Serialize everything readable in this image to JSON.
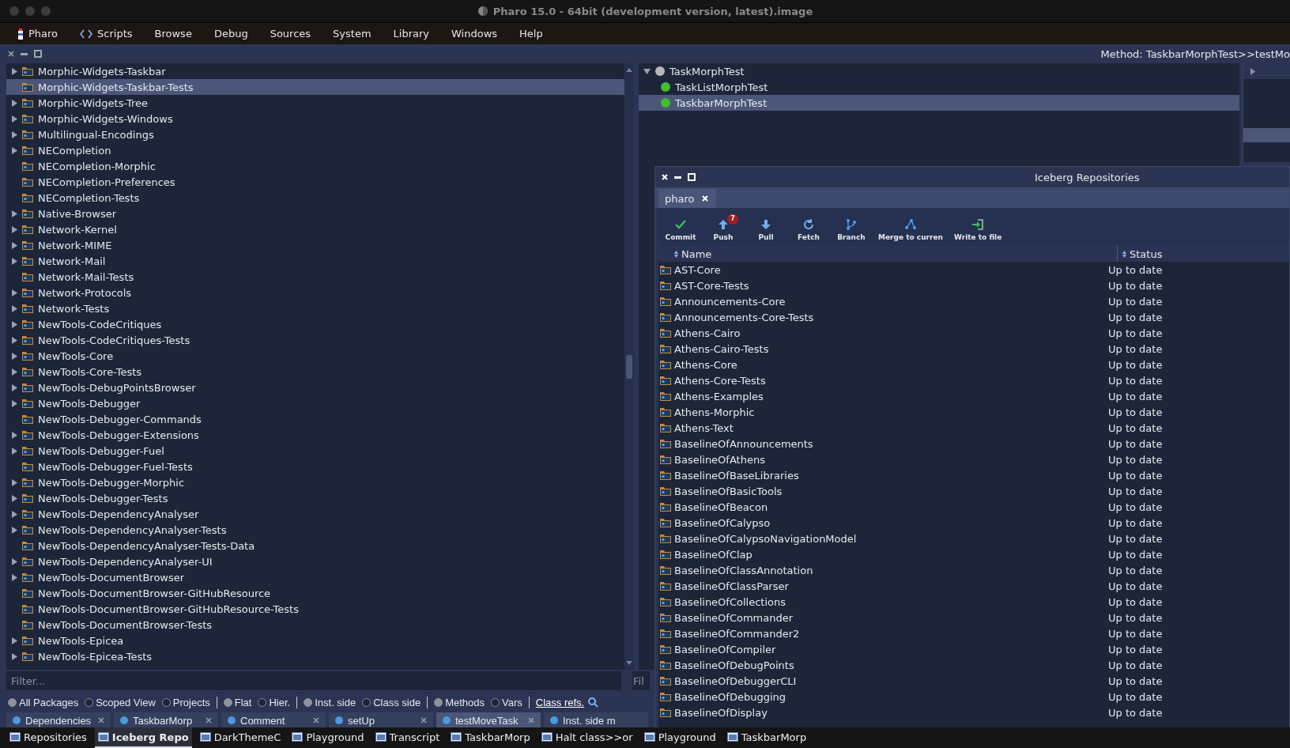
{
  "window": {
    "title": "Pharo 15.0 - 64bit (development version, latest).image"
  },
  "menu_bar": [
    {
      "label": "Pharo"
    },
    {
      "label": "Scripts"
    },
    {
      "label": "Browse"
    },
    {
      "label": "Debug"
    },
    {
      "label": "Sources"
    },
    {
      "label": "System"
    },
    {
      "label": "Library"
    },
    {
      "label": "Windows"
    },
    {
      "label": "Help"
    }
  ],
  "browser": {
    "header": "Method: TaskbarMorphTest>>testMo",
    "packages": [
      {
        "name": "Morphic-Widgets-Taskbar",
        "expandable": true,
        "selected": false
      },
      {
        "name": "Morphic-Widgets-Taskbar-Tests",
        "expandable": false,
        "selected": true
      },
      {
        "name": "Morphic-Widgets-Tree",
        "expandable": true,
        "selected": false
      },
      {
        "name": "Morphic-Widgets-Windows",
        "expandable": true,
        "selected": false
      },
      {
        "name": "Multilingual-Encodings",
        "expandable": true,
        "selected": false
      },
      {
        "name": "NECompletion",
        "expandable": true,
        "selected": false
      },
      {
        "name": "NECompletion-Morphic",
        "expandable": false,
        "selected": false
      },
      {
        "name": "NECompletion-Preferences",
        "expandable": false,
        "selected": false
      },
      {
        "name": "NECompletion-Tests",
        "expandable": false,
        "selected": false
      },
      {
        "name": "Native-Browser",
        "expandable": true,
        "selected": false
      },
      {
        "name": "Network-Kernel",
        "expandable": true,
        "selected": false
      },
      {
        "name": "Network-MIME",
        "expandable": true,
        "selected": false
      },
      {
        "name": "Network-Mail",
        "expandable": true,
        "selected": false
      },
      {
        "name": "Network-Mail-Tests",
        "expandable": false,
        "selected": false
      },
      {
        "name": "Network-Protocols",
        "expandable": true,
        "selected": false
      },
      {
        "name": "Network-Tests",
        "expandable": true,
        "selected": false
      },
      {
        "name": "NewTools-CodeCritiques",
        "expandable": true,
        "selected": false
      },
      {
        "name": "NewTools-CodeCritiques-Tests",
        "expandable": true,
        "selected": false
      },
      {
        "name": "NewTools-Core",
        "expandable": true,
        "selected": false
      },
      {
        "name": "NewTools-Core-Tests",
        "expandable": true,
        "selected": false
      },
      {
        "name": "NewTools-DebugPointsBrowser",
        "expandable": true,
        "selected": false
      },
      {
        "name": "NewTools-Debugger",
        "expandable": true,
        "selected": false
      },
      {
        "name": "NewTools-Debugger-Commands",
        "expandable": false,
        "selected": false
      },
      {
        "name": "NewTools-Debugger-Extensions",
        "expandable": true,
        "selected": false
      },
      {
        "name": "NewTools-Debugger-Fuel",
        "expandable": true,
        "selected": false
      },
      {
        "name": "NewTools-Debugger-Fuel-Tests",
        "expandable": false,
        "selected": false
      },
      {
        "name": "NewTools-Debugger-Morphic",
        "expandable": true,
        "selected": false
      },
      {
        "name": "NewTools-Debugger-Tests",
        "expandable": true,
        "selected": false
      },
      {
        "name": "NewTools-DependencyAnalyser",
        "expandable": true,
        "selected": false
      },
      {
        "name": "NewTools-DependencyAnalyser-Tests",
        "expandable": true,
        "selected": false
      },
      {
        "name": "NewTools-DependencyAnalyser-Tests-Data",
        "expandable": false,
        "selected": false
      },
      {
        "name": "NewTools-DependencyAnalyser-UI",
        "expandable": true,
        "selected": false
      },
      {
        "name": "NewTools-DocumentBrowser",
        "expandable": true,
        "selected": false
      },
      {
        "name": "NewTools-DocumentBrowser-GitHubResource",
        "expandable": false,
        "selected": false
      },
      {
        "name": "NewTools-DocumentBrowser-GitHubResource-Tests",
        "expandable": false,
        "selected": false
      },
      {
        "name": "NewTools-DocumentBrowser-Tests",
        "expandable": false,
        "selected": false
      },
      {
        "name": "NewTools-Epicea",
        "expandable": true,
        "selected": false
      },
      {
        "name": "NewTools-Epicea-Tests",
        "expandable": true,
        "selected": false
      }
    ],
    "classes": [
      {
        "name": "TaskMorphTest",
        "color": "#b8b8b8",
        "expanded": true,
        "selected": false,
        "children": [
          {
            "name": "TaskListMorphTest",
            "color": "#3fbf2f",
            "selected": false
          },
          {
            "name": "TaskbarMorphTest",
            "color": "#3fbf2f",
            "selected": true
          }
        ]
      }
    ],
    "package_filter": {
      "placeholder": "Filter..."
    },
    "class_filter": {
      "placeholder": "Fil"
    },
    "radio_groups": [
      [
        {
          "label": "All Packages",
          "selected": true
        },
        {
          "label": "Scoped View",
          "selected": false
        },
        {
          "label": "Projects",
          "selected": false
        }
      ],
      [
        {
          "label": "Flat",
          "selected": true
        },
        {
          "label": "Hier.",
          "selected": false
        }
      ],
      [
        {
          "label": "Inst. side",
          "selected": true
        },
        {
          "label": "Class side",
          "selected": false
        }
      ],
      [
        {
          "label": "Methods",
          "selected": true
        },
        {
          "label": "Vars",
          "selected": false
        }
      ]
    ],
    "link": "Class refs.",
    "tabs": [
      {
        "label": "Dependencies",
        "selected": false
      },
      {
        "label": "TaskbarMorp",
        "selected": false
      },
      {
        "label": "Comment",
        "selected": false
      },
      {
        "label": "setUp",
        "selected": false
      },
      {
        "label": "testMoveTask",
        "selected": true
      },
      {
        "label": "Inst. side m",
        "selected": false
      }
    ]
  },
  "iceberg": {
    "title": "Iceberg Repositories",
    "tab": "pharo",
    "toolbar": [
      {
        "label": "Commit"
      },
      {
        "label": "Push",
        "badge": "7"
      },
      {
        "label": "Pull"
      },
      {
        "label": "Fetch"
      },
      {
        "label": "Branch"
      },
      {
        "label": "Merge to curren"
      },
      {
        "label": "Write to file"
      }
    ],
    "columns": [
      "Name",
      "Status"
    ],
    "rows": [
      {
        "name": "AST-Core",
        "status": "Up to date"
      },
      {
        "name": "AST-Core-Tests",
        "status": "Up to date"
      },
      {
        "name": "Announcements-Core",
        "status": "Up to date"
      },
      {
        "name": "Announcements-Core-Tests",
        "status": "Up to date"
      },
      {
        "name": "Athens-Cairo",
        "status": "Up to date"
      },
      {
        "name": "Athens-Cairo-Tests",
        "status": "Up to date"
      },
      {
        "name": "Athens-Core",
        "status": "Up to date"
      },
      {
        "name": "Athens-Core-Tests",
        "status": "Up to date"
      },
      {
        "name": "Athens-Examples",
        "status": "Up to date"
      },
      {
        "name": "Athens-Morphic",
        "status": "Up to date"
      },
      {
        "name": "Athens-Text",
        "status": "Up to date"
      },
      {
        "name": "BaselineOfAnnouncements",
        "status": "Up to date"
      },
      {
        "name": "BaselineOfAthens",
        "status": "Up to date"
      },
      {
        "name": "BaselineOfBaseLibraries",
        "status": "Up to date"
      },
      {
        "name": "BaselineOfBasicTools",
        "status": "Up to date"
      },
      {
        "name": "BaselineOfBeacon",
        "status": "Up to date"
      },
      {
        "name": "BaselineOfCalypso",
        "status": "Up to date"
      },
      {
        "name": "BaselineOfCalypsoNavigationModel",
        "status": "Up to date"
      },
      {
        "name": "BaselineOfClap",
        "status": "Up to date"
      },
      {
        "name": "BaselineOfClassAnnotation",
        "status": "Up to date"
      },
      {
        "name": "BaselineOfClassParser",
        "status": "Up to date"
      },
      {
        "name": "BaselineOfCollections",
        "status": "Up to date"
      },
      {
        "name": "BaselineOfCommander",
        "status": "Up to date"
      },
      {
        "name": "BaselineOfCommander2",
        "status": "Up to date"
      },
      {
        "name": "BaselineOfCompiler",
        "status": "Up to date"
      },
      {
        "name": "BaselineOfDebugPoints",
        "status": "Up to date"
      },
      {
        "name": "BaselineOfDebuggerCLI",
        "status": "Up to date"
      },
      {
        "name": "BaselineOfDebugging",
        "status": "Up to date"
      },
      {
        "name": "BaselineOfDisplay",
        "status": "Up to date"
      }
    ]
  },
  "taskbar": [
    {
      "label": "Repositories",
      "selected": false
    },
    {
      "label": "Iceberg Repo",
      "selected": true
    },
    {
      "label": "DarkThemeC",
      "selected": false
    },
    {
      "label": "Playground",
      "selected": false
    },
    {
      "label": "Transcript",
      "selected": false
    },
    {
      "label": "TaskbarMorp",
      "selected": false
    },
    {
      "label": "Halt class>>or",
      "selected": false
    },
    {
      "label": "Playground",
      "selected": false
    },
    {
      "label": "TaskbarMorp",
      "selected": false
    }
  ]
}
